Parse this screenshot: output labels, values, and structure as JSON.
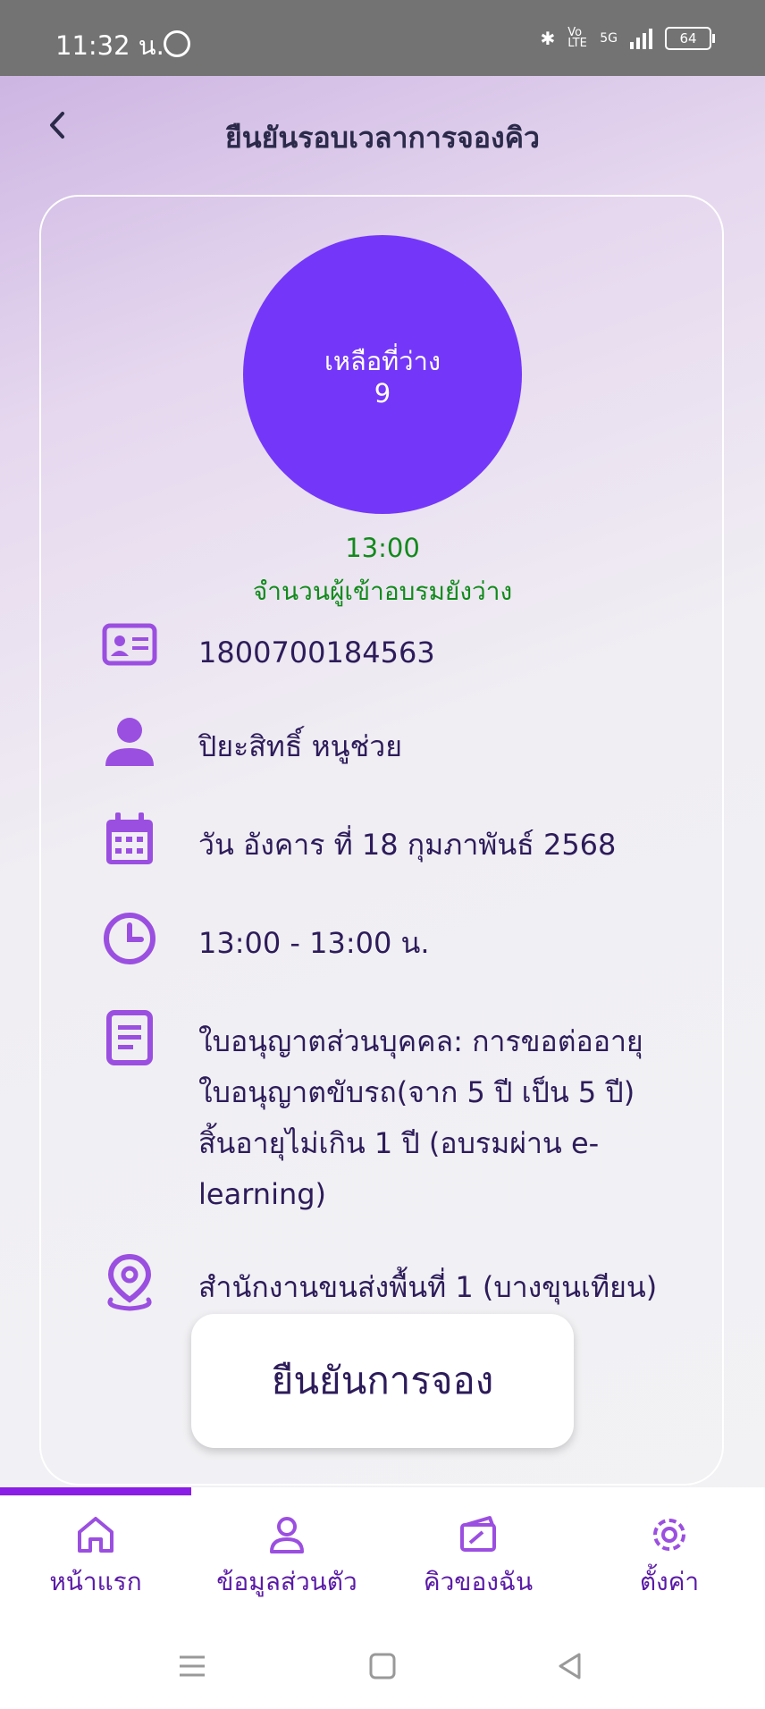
{
  "status_bar": {
    "time": "11:32 น.",
    "volte": "Vo LTE",
    "network": "5G",
    "battery": "64"
  },
  "header": {
    "title": "ยืนยันรอบเวลาการจองคิว"
  },
  "availability": {
    "label": "เหลือที่ว่าง",
    "count": "9",
    "color": "#7437f9"
  },
  "slot": {
    "time": "13:00",
    "status": "จำนวนผู้เข้าอบรมยังว่าง",
    "status_color": "#118a1b"
  },
  "details": {
    "id_number": "1800700184563",
    "name": "ปิยะสิทธิ์ หนูช่วย",
    "date": "วัน อังคาร ที่ 18 กุมภาพันธ์ 2568",
    "time_range": "13:00 - 13:00 น.",
    "service": "ใบอนุญาตส่วนบุคคล: การขอต่ออายุใบอนุญาตขับรถ(จาก 5 ปี เป็น 5 ปี) สิ้นอายุไม่เกิน 1 ปี (อบรมผ่าน e-learning)",
    "location": "สำนักงานขนส่งพื้นที่ 1 (บางขุนเทียน)"
  },
  "confirm_button": {
    "label": "ยืนยันการจอง"
  },
  "bottom_nav": {
    "items": [
      {
        "label": "หน้าแรก",
        "icon": "home-icon"
      },
      {
        "label": "ข้อมูลส่วนตัว",
        "icon": "profile-icon"
      },
      {
        "label": "คิวของฉัน",
        "icon": "ticket-icon"
      },
      {
        "label": "ตั้งค่า",
        "icon": "gear-icon"
      }
    ],
    "active_index": 0
  },
  "colors": {
    "accent": "#7437f9",
    "icon": "#9b4fe0",
    "nav": "#5a1aa6",
    "text": "#2d1c5a"
  }
}
